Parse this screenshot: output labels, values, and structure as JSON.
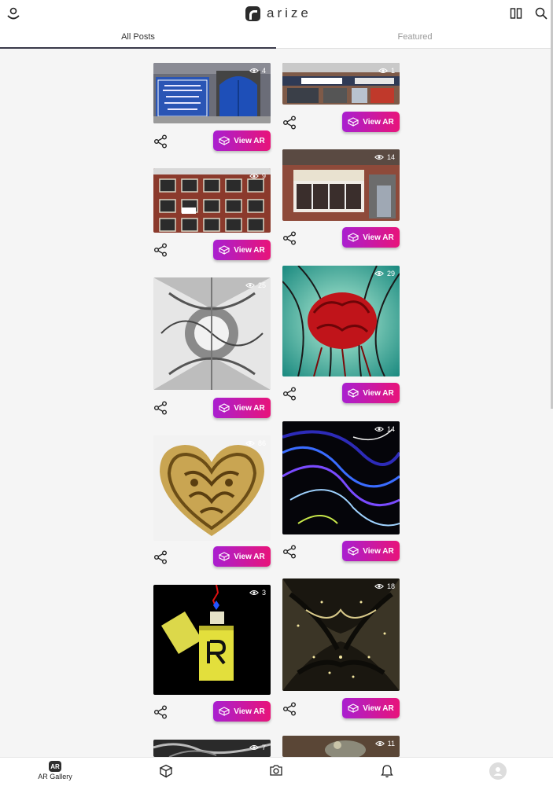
{
  "app": {
    "brand": "arize"
  },
  "tabs": [
    {
      "label": "All Posts"
    },
    {
      "label": "Featured"
    }
  ],
  "action_label": "View AR",
  "posts": [
    {
      "views": "4"
    },
    {
      "views": "1"
    },
    {
      "views": "14"
    },
    {
      "views": "9"
    },
    {
      "views": "25"
    },
    {
      "views": "29"
    },
    {
      "views": "86"
    },
    {
      "views": "14"
    },
    {
      "views": "3"
    },
    {
      "views": "18"
    },
    {
      "views": "7"
    },
    {
      "views": "11"
    }
  ],
  "nav": {
    "gallery_label": "AR Gallery",
    "gallery_badge": "AR"
  },
  "colors": {
    "accent_start": "#a91fd0",
    "accent_end": "#e8147a"
  },
  "icons": [
    "user-location-icon",
    "layout-columns-icon",
    "search-icon",
    "eye-icon",
    "share-icon",
    "cube-icon",
    "camera-icon",
    "bell-icon",
    "avatar-icon"
  ]
}
